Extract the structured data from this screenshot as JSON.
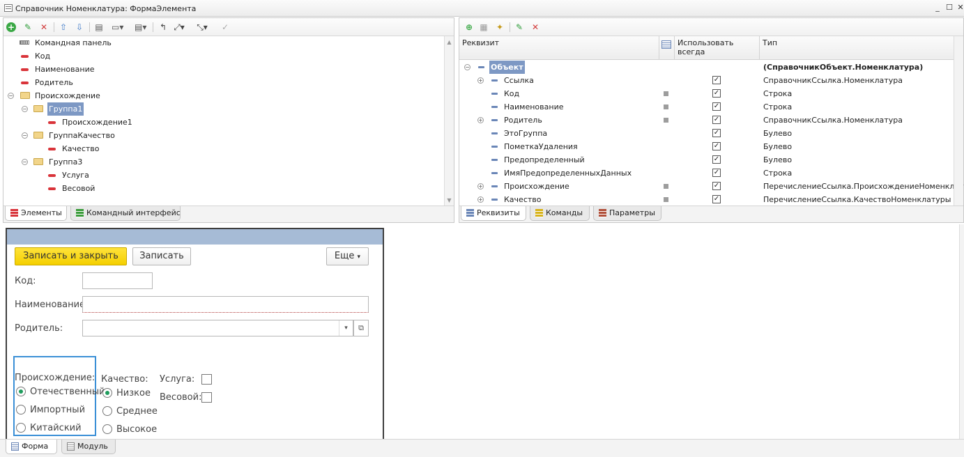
{
  "window": {
    "title": "Справочник Номенклатура: ФормаЭлемента",
    "icon": "form-icon",
    "btn_min": "_",
    "btn_max": "☐",
    "btn_close": "✕"
  },
  "left_tree": {
    "items": [
      {
        "label": "Командная панель"
      },
      {
        "label": "Код"
      },
      {
        "label": "Наименование"
      },
      {
        "label": "Родитель"
      },
      {
        "label": "Происхождение"
      },
      {
        "label": "Группа1"
      },
      {
        "label": "Происхождение1"
      },
      {
        "label": "ГруппаКачество"
      },
      {
        "label": "Качество"
      },
      {
        "label": "Группа3"
      },
      {
        "label": "Услуга"
      },
      {
        "label": "Весовой"
      }
    ],
    "tabs": [
      {
        "label": "Элементы"
      },
      {
        "label": "Командный интерфейс"
      }
    ]
  },
  "right_grid": {
    "headers": {
      "rekvizit": "Реквизит",
      "use_always": "Использовать всегда",
      "type": "Тип"
    },
    "rows": [
      {
        "name": "Объект",
        "type": "(СправочникОбъект.Номенклатура)"
      },
      {
        "name": "Ссылка",
        "type": "СправочникСсылка.Номенклатура"
      },
      {
        "name": "Код",
        "type": "Строка"
      },
      {
        "name": "Наименование",
        "type": "Строка"
      },
      {
        "name": "Родитель",
        "type": "СправочникСсылка.Номенклатура"
      },
      {
        "name": "ЭтоГруппа",
        "type": "Булево"
      },
      {
        "name": "ПометкаУдаления",
        "type": "Булево"
      },
      {
        "name": "Предопределенный",
        "type": "Булево"
      },
      {
        "name": "ИмяПредопределенныхДанных",
        "type": "Строка"
      },
      {
        "name": "Происхождение",
        "type": "ПеречислениеСсылка.ПроисхождениеНоменклатуры"
      },
      {
        "name": "Качество",
        "type": "ПеречислениеСсылка.КачествоНоменклатуры"
      }
    ],
    "tabs": [
      {
        "label": "Реквизиты"
      },
      {
        "label": "Команды"
      },
      {
        "label": "Параметры"
      }
    ]
  },
  "form_preview": {
    "btn_save_close": "Записать и закрыть",
    "btn_save": "Записать",
    "btn_more": "Еще",
    "more_arrow": "▾",
    "label_code": "Код:",
    "label_name": "Наименование:",
    "label_parent": "Родитель:",
    "dropdown_arrow": "▾",
    "open_icon": "⧉",
    "origin": {
      "label": "Происхождение:",
      "options": [
        "Отечественный",
        "Импортный",
        "Китайский"
      ],
      "selected": "Отечественный"
    },
    "quality": {
      "label": "Качество:",
      "options": [
        "Низкое",
        "Среднее",
        "Высокое"
      ],
      "selected": "Низкое"
    },
    "service": {
      "label": "Услуга:"
    },
    "weighted": {
      "label": "Весовой:"
    }
  },
  "bottom_tabs": [
    {
      "label": "Форма"
    },
    {
      "label": "Модуль"
    }
  ],
  "glyphs": {
    "check": "✓",
    "plus": "⊕",
    "minus": "⊖",
    "up": "▲",
    "down": "▼"
  }
}
